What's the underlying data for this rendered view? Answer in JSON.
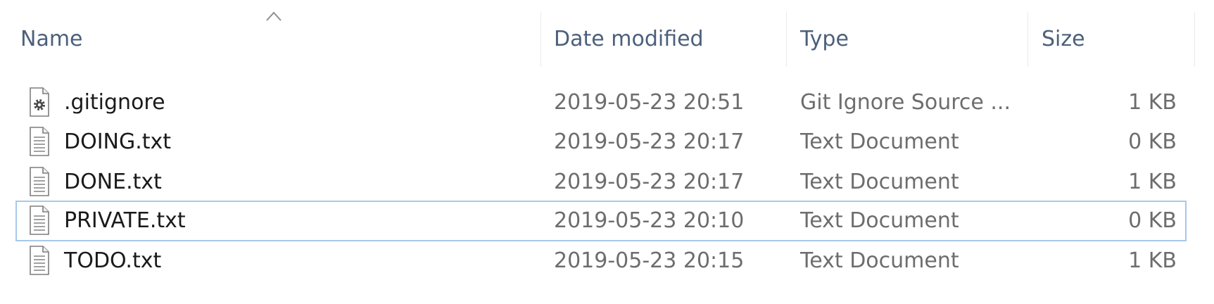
{
  "columns": {
    "name": "Name",
    "date_modified": "Date modified",
    "type": "Type",
    "size": "Size"
  },
  "sort": {
    "column": "name",
    "direction": "ascending",
    "icon": "chevron-up-icon"
  },
  "files": [
    {
      "name": ".gitignore",
      "date_modified": "2019-05-23 20:51",
      "type": "Git Ignore Source ...",
      "size": "1 KB",
      "icon": "settings-file-icon",
      "selected": false
    },
    {
      "name": "DOING.txt",
      "date_modified": "2019-05-23 20:17",
      "type": "Text Document",
      "size": "0 KB",
      "icon": "text-file-icon",
      "selected": false
    },
    {
      "name": "DONE.txt",
      "date_modified": "2019-05-23 20:17",
      "type": "Text Document",
      "size": "1 KB",
      "icon": "text-file-icon",
      "selected": false
    },
    {
      "name": "PRIVATE.txt",
      "date_modified": "2019-05-23 20:10",
      "type": "Text Document",
      "size": "0 KB",
      "icon": "text-file-icon",
      "selected": true
    },
    {
      "name": "TODO.txt",
      "date_modified": "2019-05-23 20:15",
      "type": "Text Document",
      "size": "1 KB",
      "icon": "text-file-icon",
      "selected": false
    }
  ],
  "colors": {
    "header_text": "#4c607a",
    "selection_border": "#a8c8ea",
    "meta_text": "#6d6d6d"
  }
}
